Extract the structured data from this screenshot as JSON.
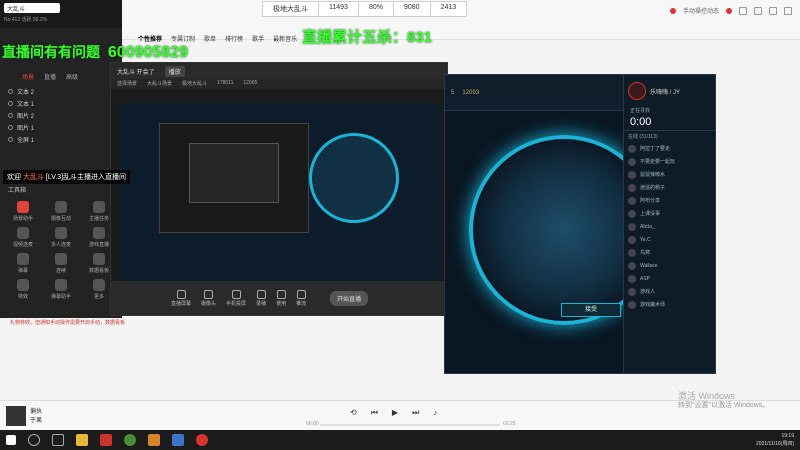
{
  "overlay": {
    "top_left_text": "直播间有有问题",
    "id_text": "600905829",
    "kills_text": "直播累计五杀：831",
    "welcome_prefix": "欢迎",
    "welcome_name": "大乱斗",
    "welcome_suffix": "[LV.3]乱斗主播进入直播间"
  },
  "music_top": {
    "nav": [
      "个性推荐",
      "专属订制",
      "歌单",
      "排行榜",
      "歌手",
      "最新音乐"
    ],
    "stats": [
      "极地大乱斗",
      "11493",
      "80%",
      "9080",
      "2413"
    ],
    "right_text": "手动操控动态"
  },
  "stream_app": {
    "search": "大乱斗",
    "stat_line": "No.413  活跃 99.2%",
    "tabs": [
      "场景",
      "直播",
      "高级"
    ],
    "layers": [
      "文本 2",
      "文本 1",
      "图片 2",
      "图片 1",
      "全屏 1"
    ],
    "tools_title": "工具箱",
    "tools": [
      "场景助手",
      "摄像互动",
      "主播任务",
      "视频连麦",
      "多人连麦",
      "游戏直播",
      "弹幕",
      "连续",
      "数据看板",
      "特效",
      "弹幕助手",
      "更多"
    ],
    "footer": "礼物特效，但通知手动操作需要开启手动，数据看板"
  },
  "preview": {
    "title": "大乱斗 开会了",
    "title_btn": "播放",
    "sub": [
      "选择场景",
      "大乱斗场景",
      "极地大乱斗",
      "178011",
      "12065"
    ],
    "bottom_btns": [
      "直播屏幕",
      "摄像头",
      "手机投屏",
      "录播",
      "使用",
      "推流"
    ],
    "start_btn": "开始直播"
  },
  "game": {
    "top": [
      "5",
      "12093"
    ],
    "name": "乐嗨嗨 / JY",
    "status": "正在寻找",
    "timer": "0:00",
    "friends_title": "在线 (31/113)",
    "friends": [
      "阿拉丁了要走",
      "不要走要一起玩",
      "鼠鼠辣椒水",
      "逍遥的帽子",
      "阿布分享",
      "上课没事",
      "Alicia_",
      "Ye.C",
      "鸟窝",
      "Wallace",
      "ASP",
      "游戏人",
      "游戏魔术师"
    ],
    "accept": "接受",
    "ranking": "rankingface"
  },
  "music_bar": {
    "song": "偏执",
    "artist": "于果",
    "time_start": "00:00",
    "time_end": "03:25",
    "progress": 0.0
  },
  "activate": {
    "title": "激活 Windows",
    "sub": "转到\"设置\"以激活 Windows。"
  },
  "taskbar": {
    "time": "19:19",
    "date": "2021/11/16(周四)"
  }
}
